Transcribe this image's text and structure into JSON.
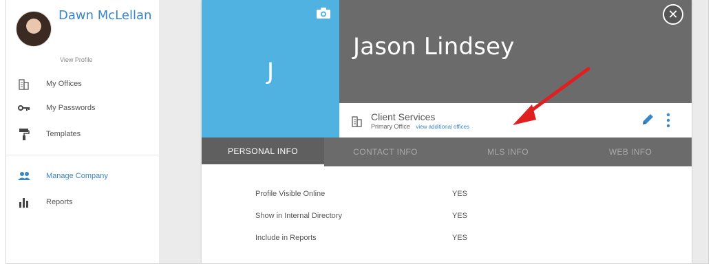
{
  "sidebar": {
    "user": {
      "name": "Dawn McLellan",
      "view_profile": "View Profile"
    },
    "items": [
      {
        "label": "My Offices",
        "icon": "building-icon"
      },
      {
        "label": "My Passwords",
        "icon": "key-icon"
      },
      {
        "label": "Templates",
        "icon": "paint-roller-icon"
      }
    ],
    "secondary_items": [
      {
        "label": "Manage Company",
        "icon": "people-icon",
        "active": true
      },
      {
        "label": "Reports",
        "icon": "bar-chart-icon"
      }
    ]
  },
  "card": {
    "initial": "J",
    "name": "Jason Lindsey",
    "office": {
      "name": "Client Services",
      "type": "Primary Office",
      "link": "view additional offices"
    },
    "tabs": [
      {
        "label": "PERSONAL INFO",
        "active": true
      },
      {
        "label": "CONTACT INFO"
      },
      {
        "label": "MLS INFO"
      },
      {
        "label": "WEB INFO"
      }
    ],
    "rows": [
      {
        "label": "Profile Visible Online",
        "value": "YES"
      },
      {
        "label": "Show in Internal Directory",
        "value": "YES"
      },
      {
        "label": "Include in Reports",
        "value": "YES"
      }
    ]
  },
  "colors": {
    "accent": "#3a86c4",
    "photo_bg": "#4fb2e0",
    "header_gray": "#6b6b6b",
    "annotation_arrow": "#e02020"
  }
}
